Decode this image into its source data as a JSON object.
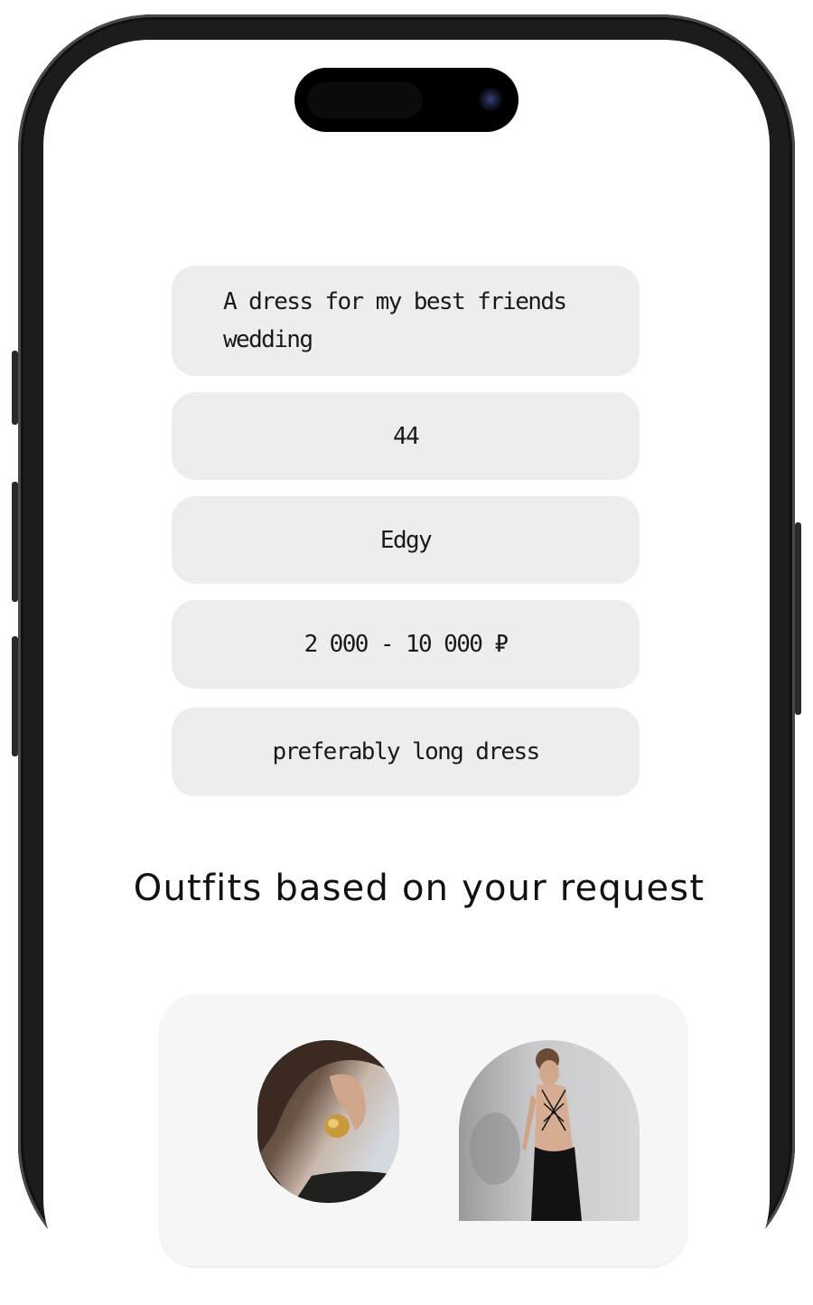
{
  "answers": [
    "A dress for my best friends wedding",
    "44",
    "Edgy",
    "2 000 - 10 000 ₽",
    "preferably long dress"
  ],
  "heading": "Outfits based on your request",
  "results": {
    "images": [
      "gold-earring-photo",
      "black-backless-dress-photo"
    ]
  }
}
